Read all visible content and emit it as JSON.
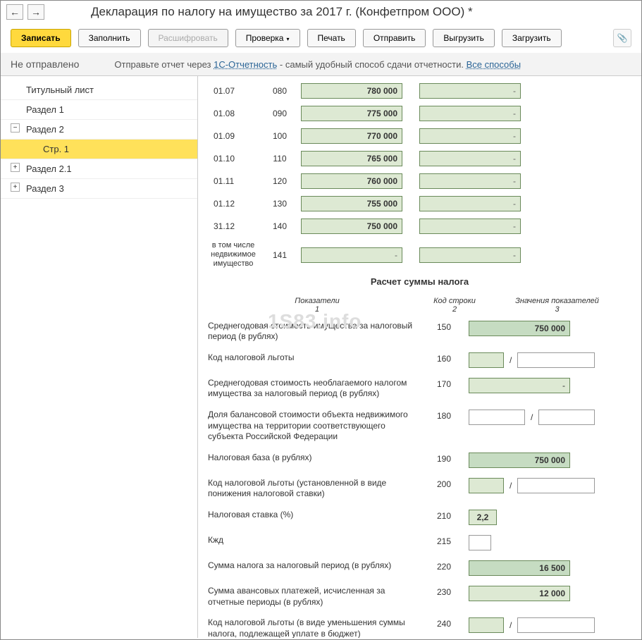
{
  "nav": {
    "back": "←",
    "fwd": "→"
  },
  "title": "Декларация по налогу на имущество за 2017 г. (Конфетпром ООО) *",
  "toolbar": {
    "zapisat": "Записать",
    "zapolnit": "Заполнить",
    "rasshifr": "Расшифровать",
    "proverka": "Проверка",
    "pechat": "Печать",
    "otpravit": "Отправить",
    "vygruzit": "Выгрузить",
    "zagruzit": "Загрузить"
  },
  "status": {
    "left": "Не отправлено",
    "mid_pre": "Отправьте отчет через ",
    "mid_link1": "1С-Отчетность",
    "mid_post": " - самый удобный способ сдачи отчетности. ",
    "mid_link2": "Все способы"
  },
  "tree": {
    "i0": "Титульный лист",
    "i1": "Раздел 1",
    "i2": "Раздел 2",
    "i2_0": "Стр. 1",
    "i3": "Раздел 2.1",
    "i4": "Раздел 3"
  },
  "grid": [
    {
      "date": "01.07",
      "code": "080",
      "val": "780 000"
    },
    {
      "date": "01.08",
      "code": "090",
      "val": "775 000"
    },
    {
      "date": "01.09",
      "code": "100",
      "val": "770 000"
    },
    {
      "date": "01.10",
      "code": "110",
      "val": "765 000"
    },
    {
      "date": "01.11",
      "code": "120",
      "val": "760 000"
    },
    {
      "date": "01.12",
      "code": "130",
      "val": "755 000"
    },
    {
      "date": "31.12",
      "code": "140",
      "val": "750 000"
    }
  ],
  "grid_extra": {
    "label": "в том числе недвижимое имущество",
    "code": "141"
  },
  "section_head": "Расчет суммы налога",
  "cols": {
    "c1": "Показатели\n1",
    "c2": "Код строки\n2",
    "c3": "Значения показателей\n3"
  },
  "details": {
    "d150": {
      "desc": "Среднегодовая стоимость имущества за налоговый период (в рублях)",
      "code": "150",
      "val": "750 000"
    },
    "d160": {
      "desc": "Код налоговой льготы",
      "code": "160",
      "sep": "/"
    },
    "d170": {
      "desc": "Среднегодовая стоимость необлагаемого налогом имущества за налоговый период (в рублях)",
      "code": "170"
    },
    "d180": {
      "desc": "Доля балансовой стоимости объекта недвижимого имущества на территории соответствующего субъекта Российской Федерации",
      "code": "180",
      "sep": "/"
    },
    "d190": {
      "desc": "Налоговая база (в рублях)",
      "code": "190",
      "val": "750 000"
    },
    "d200": {
      "desc": "Код налоговой льготы (установленной в виде понижения налоговой ставки)",
      "code": "200",
      "sep": "/"
    },
    "d210": {
      "desc": "Налоговая ставка (%)",
      "code": "210",
      "val": "2,2"
    },
    "d215": {
      "desc": "Кжд",
      "code": "215"
    },
    "d220": {
      "desc": "Сумма налога за налоговый период (в рублях)",
      "code": "220",
      "val": "16 500"
    },
    "d230": {
      "desc": "Сумма авансовых платежей, исчисленная за отчетные периоды (в рублях)",
      "code": "230",
      "val": "12 000"
    },
    "d240": {
      "desc": "Код налоговой льготы (в виде уменьшения суммы налога, подлежащей уплате в бюджет)",
      "code": "240",
      "sep": "/"
    }
  },
  "watermark": "1S83.info"
}
